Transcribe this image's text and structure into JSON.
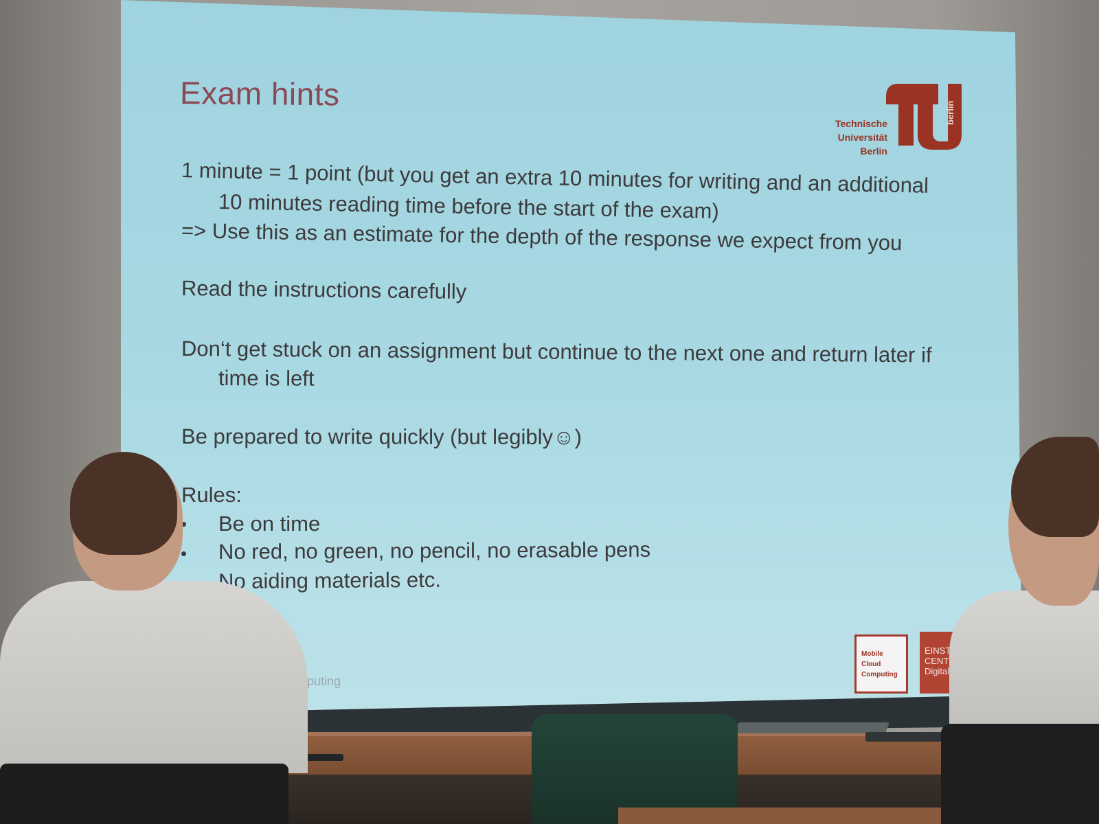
{
  "slide": {
    "title": "Exam hints",
    "lines": [
      "1 minute = 1 point (but you get an extra 10 minutes for writing and an additional",
      "10 minutes reading time before the start of the exam)",
      "=> Use this as an estimate for the depth of the response we expect from you",
      "Read the instructions carefully",
      "Don‘t get stuck on an assignment but continue to the next one and return later if",
      "time is left",
      "Be prepared to write quickly (but legibly☺)",
      "Rules:"
    ],
    "bullets": [
      "Be on time",
      "No red, no green, no pencil, no erasable pens",
      "No aiding materials etc."
    ],
    "footer": "mputing"
  },
  "logo": {
    "line1": "Technische",
    "line2": "Universität",
    "line3": "Berlin",
    "vertical": "berlin"
  },
  "partner_logos": {
    "mcc": "Mobile\nCloud\nComputing",
    "einstein": "EINST\nCENT\nDigital F"
  },
  "colors": {
    "title": "#8a4a55",
    "body_text": "#3d3a3c",
    "tu_red": "#9a3323",
    "screen": "#a8d9e3"
  }
}
